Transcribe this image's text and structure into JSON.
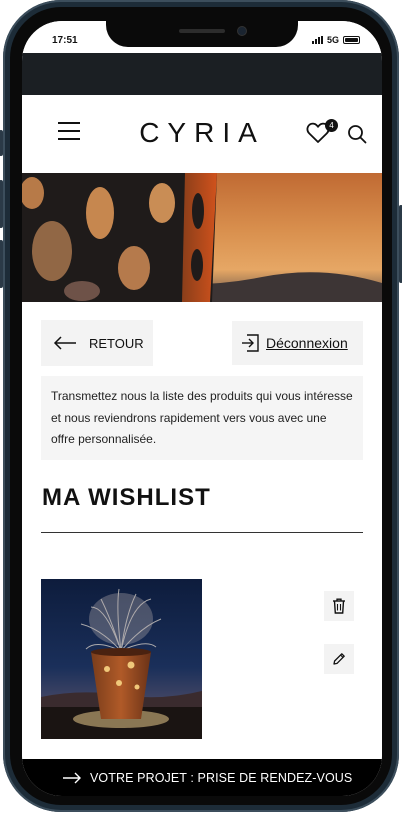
{
  "status": {
    "time": "17:51",
    "network": "5G"
  },
  "header": {
    "logo": "CYRIA",
    "wishlist_count": "4"
  },
  "actions": {
    "back_label": "RETOUR",
    "logout_label": "Déconnexion"
  },
  "info": {
    "text": "Transmettez nous la liste des produits qui vous intéresse et nous reviendrons rapidement vers vous avec une offre personnalisée."
  },
  "wishlist": {
    "title": "MA WISHLIST"
  },
  "footer": {
    "cta_label": "VOTRE PROJET : PRISE DE RENDEZ-VOUS"
  },
  "icons": [
    "menu-icon",
    "heart-icon",
    "search-icon",
    "arrow-left-icon",
    "logout-icon",
    "trash-icon",
    "pencil-icon",
    "arrow-right-icon"
  ]
}
